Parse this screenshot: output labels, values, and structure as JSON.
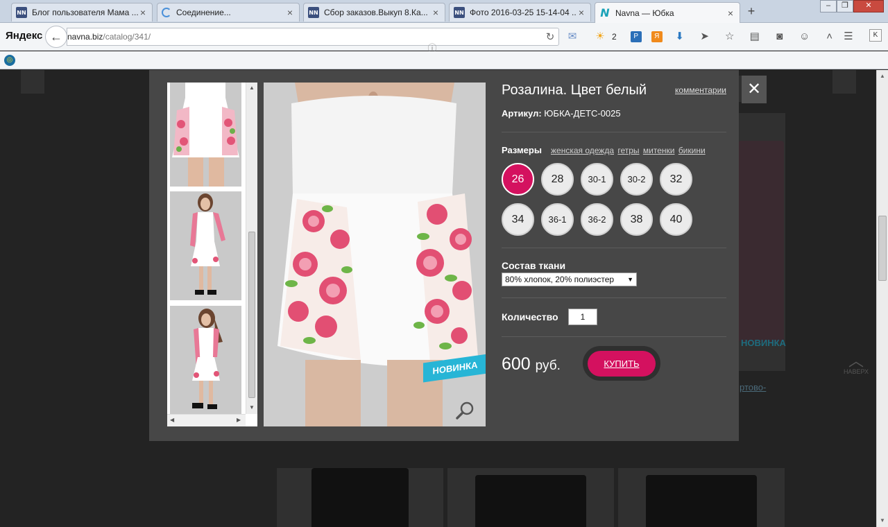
{
  "browser": {
    "tabs": [
      {
        "title": "Блог пользователя Мама ...",
        "favicon": "NN"
      },
      {
        "title": "Соединение...",
        "favicon": "loading-spinner"
      },
      {
        "title": "Сбор заказов.Выкуп 8.Ка...",
        "favicon": "NN"
      },
      {
        "title": "Фото 2016-03-25 15-14-04 ...",
        "favicon": "NN"
      },
      {
        "title": "Navna — Юбка",
        "favicon": "N",
        "active": true
      }
    ],
    "logo": "Яндекс",
    "url_host": "navna.biz",
    "url_path": "/catalog/341/",
    "weather_temp": "2",
    "profile_letter": "K"
  },
  "page_bg": {
    "badge_new": "НОВИНКА",
    "link_partial": "ртово-",
    "nav_up": "НАВЕРХ"
  },
  "modal": {
    "title": "Розалина. Цвет белый",
    "comments_link": "комментарии",
    "article_label": "Артикул:",
    "article_value": "ЮБКА-ДЕТС-0025",
    "sizes_label": "Размеры",
    "size_links": [
      "женская одежда",
      "гетры",
      "митенки",
      "бикини"
    ],
    "sizes": [
      "26",
      "28",
      "30-1",
      "30-2",
      "32",
      "34",
      "36-1",
      "36-2",
      "38",
      "40"
    ],
    "selected_size": "26",
    "fabric_label": "Состав ткани",
    "fabric_value": "80% хлопок, 20% полиэстер",
    "quantity_label": "Количество",
    "quantity_value": "1",
    "price_value": "600",
    "price_currency": "руб.",
    "buy_label": "КУПИТЬ",
    "badge_new": "НОВИНКА",
    "close": "✕",
    "accent_color": "#d4115f",
    "badge_color": "#27b5d6"
  }
}
